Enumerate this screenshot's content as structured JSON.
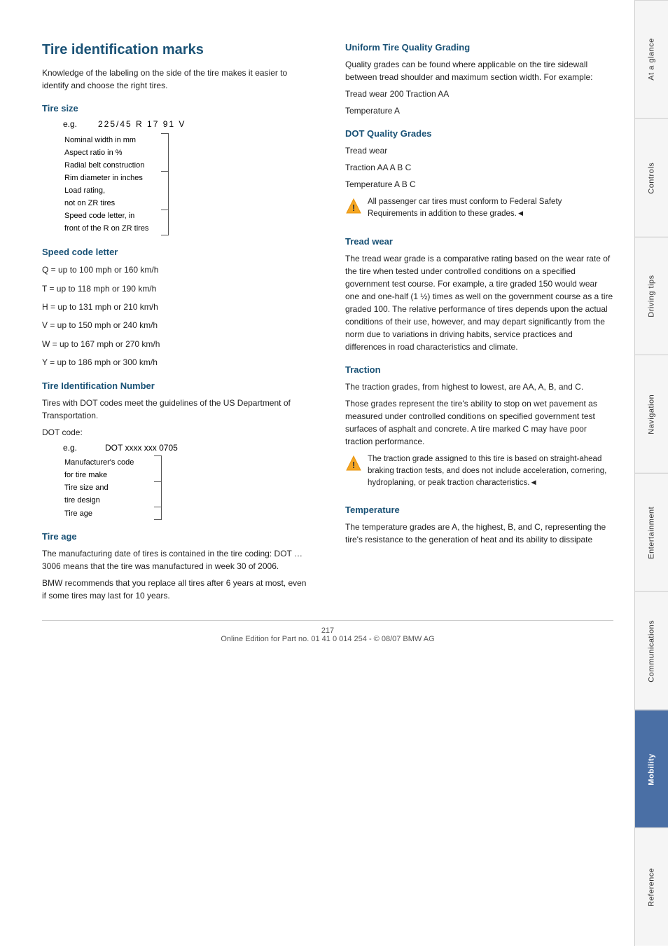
{
  "page": {
    "number": "217",
    "footer": "Online Edition for Part no. 01 41 0 014 254 - © 08/07 BMW AG"
  },
  "sidebar": {
    "tabs": [
      {
        "label": "At a glance",
        "active": false
      },
      {
        "label": "Controls",
        "active": false
      },
      {
        "label": "Driving tips",
        "active": false
      },
      {
        "label": "Navigation",
        "active": false
      },
      {
        "label": "Entertainment",
        "active": false
      },
      {
        "label": "Communications",
        "active": false
      },
      {
        "label": "Mobility",
        "active": true
      },
      {
        "label": "Reference",
        "active": false
      }
    ]
  },
  "left_col": {
    "title": "Tire identification marks",
    "intro": "Knowledge of the labeling on the side of the tire makes it easier to identify and choose the right tires.",
    "tire_size": {
      "heading": "Tire size",
      "eg_label": "e.g.",
      "eg_value": "225/45  R 17  91  V",
      "labels": [
        "Nominal width in mm",
        "Aspect ratio in %",
        "Radial belt construction",
        "Rim diameter in inches",
        "Load rating,",
        "not on ZR tires",
        "Speed code letter, in",
        "front of the R on ZR tires"
      ]
    },
    "speed_code": {
      "heading": "Speed code letter",
      "items": [
        "Q = up to 100 mph or 160 km/h",
        "T = up to 118 mph or 190 km/h",
        "H = up to 131 mph or 210 km/h",
        "V = up to 150 mph or 240 km/h",
        "W = up to 167 mph or 270 km/h",
        "Y = up to 186 mph or 300 km/h"
      ]
    },
    "tire_id": {
      "heading": "Tire Identification Number",
      "para1": "Tires with DOT codes meet the guidelines of the US Department of Transportation.",
      "dot_label": "DOT code:",
      "eg_label": "e.g.",
      "eg_value": "DOT xxxx xxx 0705",
      "dot_labels": [
        "Manufacturer's code",
        "for tire make",
        "Tire size and",
        "tire design",
        "Tire age"
      ]
    },
    "tire_age": {
      "heading": "Tire age",
      "para1": "The manufacturing date of tires is contained in the tire coding: DOT … 3006 means that the tire was manufactured in week 30 of 2006.",
      "para2": "BMW recommends that you replace all tires after 6 years at most, even if some tires may last for 10 years."
    }
  },
  "right_col": {
    "uniform_tire": {
      "heading": "Uniform Tire Quality Grading",
      "para1": "Quality grades can be found where applicable on the tire sidewall between tread shoulder and maximum section width. For example:",
      "example1": "Tread wear 200 Traction AA",
      "example2": "Temperature A"
    },
    "dot_quality": {
      "heading": "DOT Quality Grades",
      "line1": "Tread wear",
      "line2": "Traction AA A B C",
      "line3": "Temperature A B C",
      "warning": "All passenger car tires must conform to Federal Safety Requirements in addition to these grades.◄"
    },
    "tread_wear": {
      "heading": "Tread wear",
      "para": "The tread wear grade is a comparative rating based on the wear rate of the tire when tested under controlled conditions on a specified government test course. For example, a tire graded 150 would wear one and one-half (1 ½) times as well on the government course as a tire graded 100. The relative performance of tires depends upon the actual conditions of their use, however, and may depart significantly from the norm due to variations in driving habits, service practices and differences in road characteristics and climate."
    },
    "traction": {
      "heading": "Traction",
      "para1": "The traction grades, from highest to lowest, are AA, A, B, and C.",
      "para2": "Those grades represent the tire's ability to stop on wet pavement as measured under controlled conditions on specified government test surfaces of asphalt and concrete. A tire marked C may have poor traction performance.",
      "warning": "The traction grade assigned to this tire is based on straight-ahead braking traction tests, and does not include acceleration, cornering, hydroplaning, or peak traction characteristics.◄"
    },
    "temperature": {
      "heading": "Temperature",
      "para": "The temperature grades are A, the highest, B, and C, representing the tire's resistance to the generation of heat and its ability to dissipate"
    }
  }
}
